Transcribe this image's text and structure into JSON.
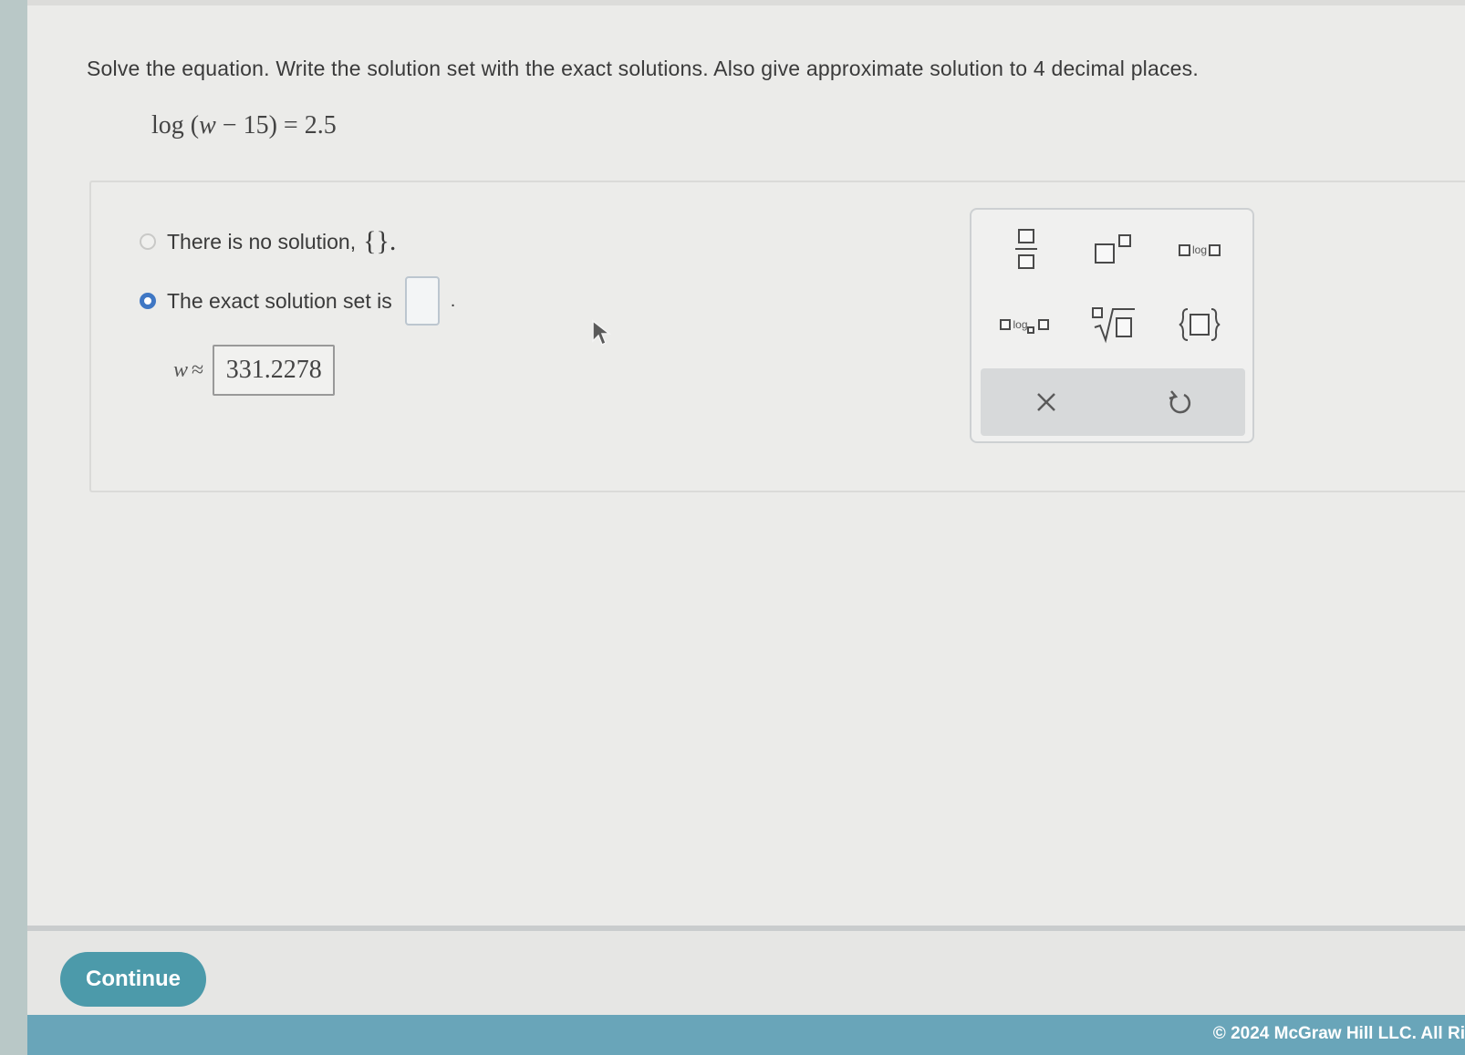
{
  "question": {
    "prompt": "Solve the equation. Write the solution set with the exact solutions. Also give approximate solution to 4 decimal places.",
    "equation": {
      "func": "log",
      "open_paren": "(",
      "variable": "w",
      "minus": " − ",
      "number": "15",
      "close_paren": ")",
      "equals": " = ",
      "rhs": "2.5"
    }
  },
  "options": [
    {
      "label": "There is no solution,",
      "braces": "{}.",
      "selected": false
    },
    {
      "label": "The exact solution set is",
      "suffix": ".",
      "selected": true
    }
  ],
  "approximation": {
    "variable": "w",
    "symbol": "≈",
    "value": "331.2278"
  },
  "palette": {
    "log_text": "log",
    "icons": [
      "fraction-icon",
      "exponent-icon",
      "log-icon",
      "log-base-icon",
      "nth-root-icon",
      "set-braces-icon",
      "clear-icon",
      "undo-icon"
    ],
    "clear_symbol": "×"
  },
  "continue_button": {
    "label": "Continue"
  },
  "footer": {
    "copyright": "© 2024 McGraw Hill LLC. All Ri"
  },
  "colors": {
    "accent": "#3f77c4",
    "continue_button": "#4c9aaa",
    "footer_bar": "#69a5b9"
  }
}
